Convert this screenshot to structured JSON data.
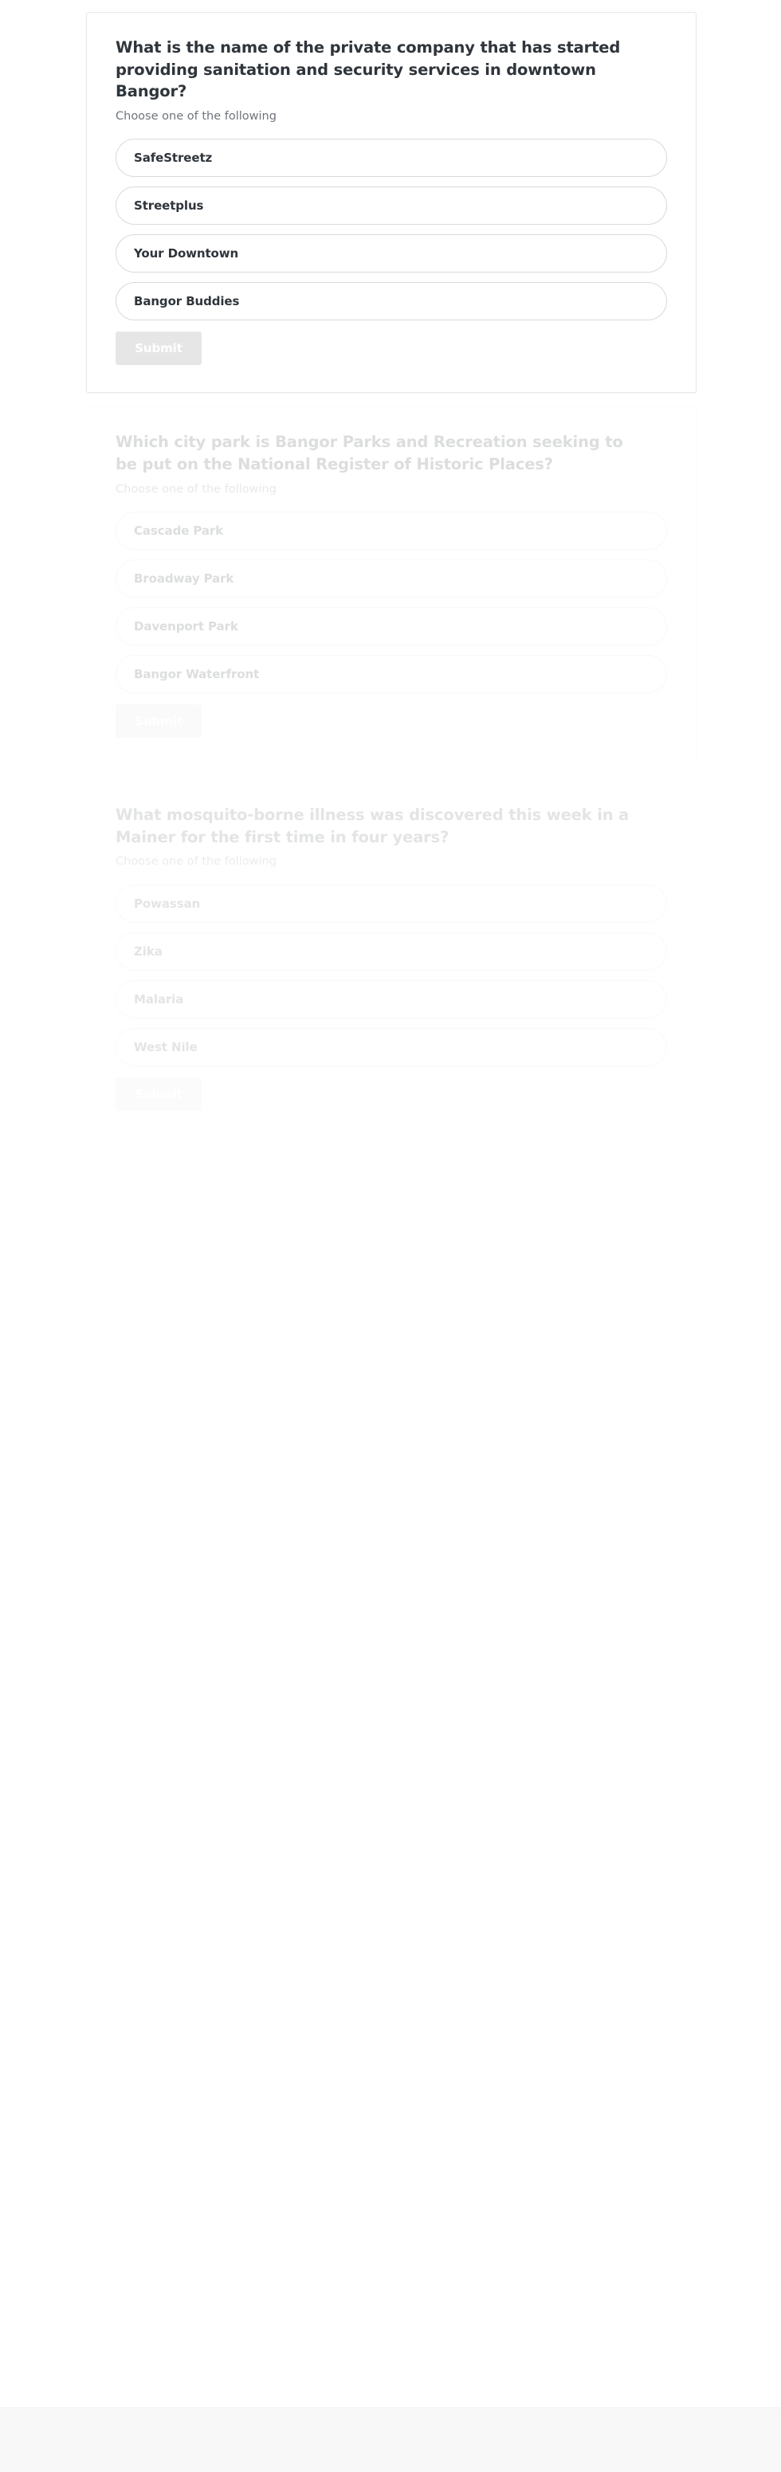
{
  "theme": {
    "page_background": "#ffffff",
    "card_background": "#ffffff",
    "card_border": "#e7e7e7",
    "question_text": "#2f353b",
    "subtitle_text": "#6f757b",
    "option_border": "#d9d9d9",
    "option_text": "#2f353b",
    "submit_background": "#e6e6e6",
    "submit_text": "#ffffff",
    "footer_background": "#f8f8f8"
  },
  "polls": [
    {
      "id": "poll-sanitation-security",
      "state": "active",
      "question": "What is the name of the private company that has started providing sanitation and security services in downtown Bangor?",
      "instruction": "Choose one of the following",
      "options": [
        "SafeStreetz",
        "Streetplus",
        "Your Downtown",
        "Bangor Buddies"
      ],
      "submit_label": "Submit"
    },
    {
      "id": "poll-city-park-historic-register",
      "state": "dimmed",
      "question": "Which city park is Bangor Parks and Recreation seeking to be put on the National Register of Historic Places?",
      "instruction": "Choose one of the following",
      "options": [
        "Cascade Park",
        "Broadway Park",
        "Davenport Park",
        "Bangor Waterfront"
      ],
      "submit_label": "Submit"
    },
    {
      "id": "poll-mosquito-borne-illness",
      "state": "dimmed",
      "question": "What mosquito-borne illness was discovered this week in a Mainer for the first time in four years?",
      "instruction": "Choose one of the following",
      "options": [
        "Powassan",
        "Zika",
        "Malaria",
        "West Nile"
      ],
      "submit_label": "Submit"
    }
  ]
}
